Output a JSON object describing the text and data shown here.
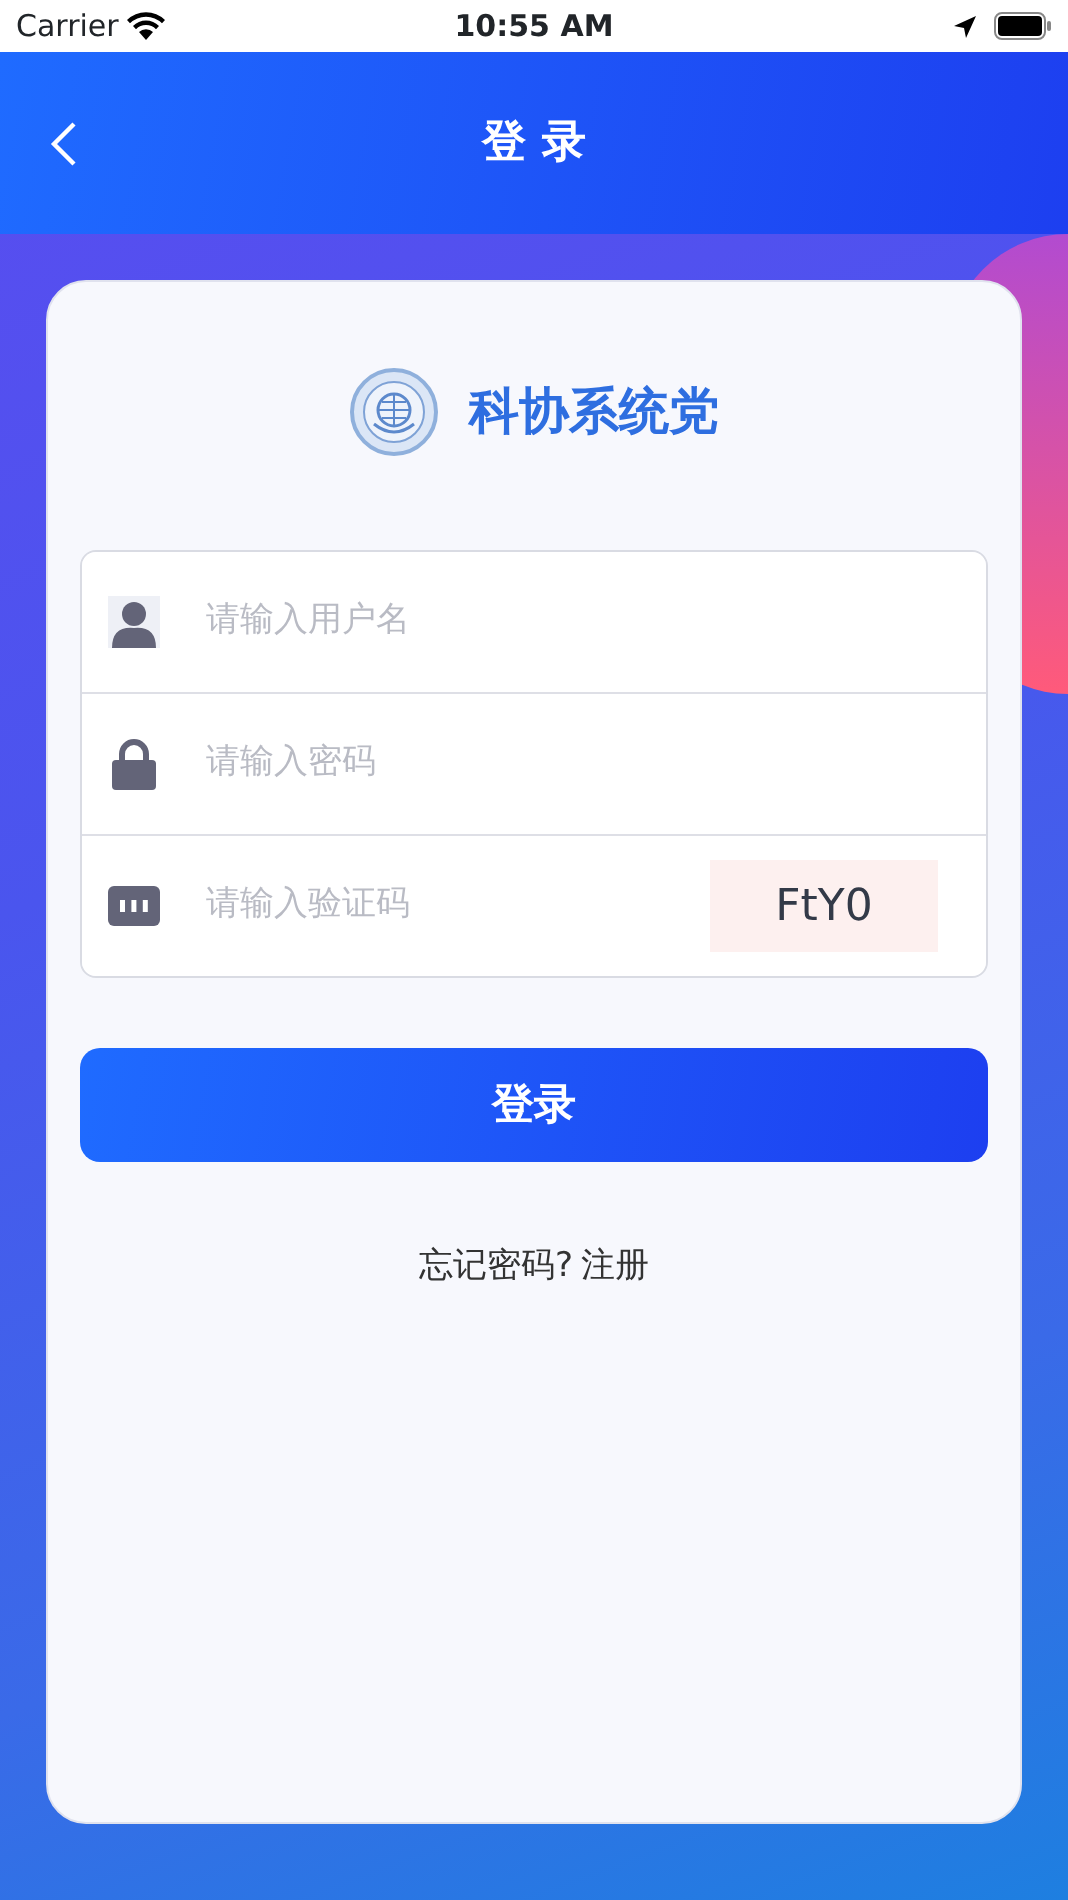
{
  "status_bar": {
    "carrier": "Carrier",
    "time": "10:55 AM"
  },
  "nav": {
    "title": "登 录"
  },
  "brand": {
    "name": "科协系统党"
  },
  "fields": [
    {
      "kind": "user",
      "placeholder": "请输入用户名"
    },
    {
      "kind": "password",
      "placeholder": "请输入密码"
    },
    {
      "kind": "captcha",
      "placeholder": "请输入验证码",
      "captcha": "FtY0"
    }
  ],
  "login_button": "登录",
  "links": [
    "忘记密码?",
    "注册"
  ]
}
